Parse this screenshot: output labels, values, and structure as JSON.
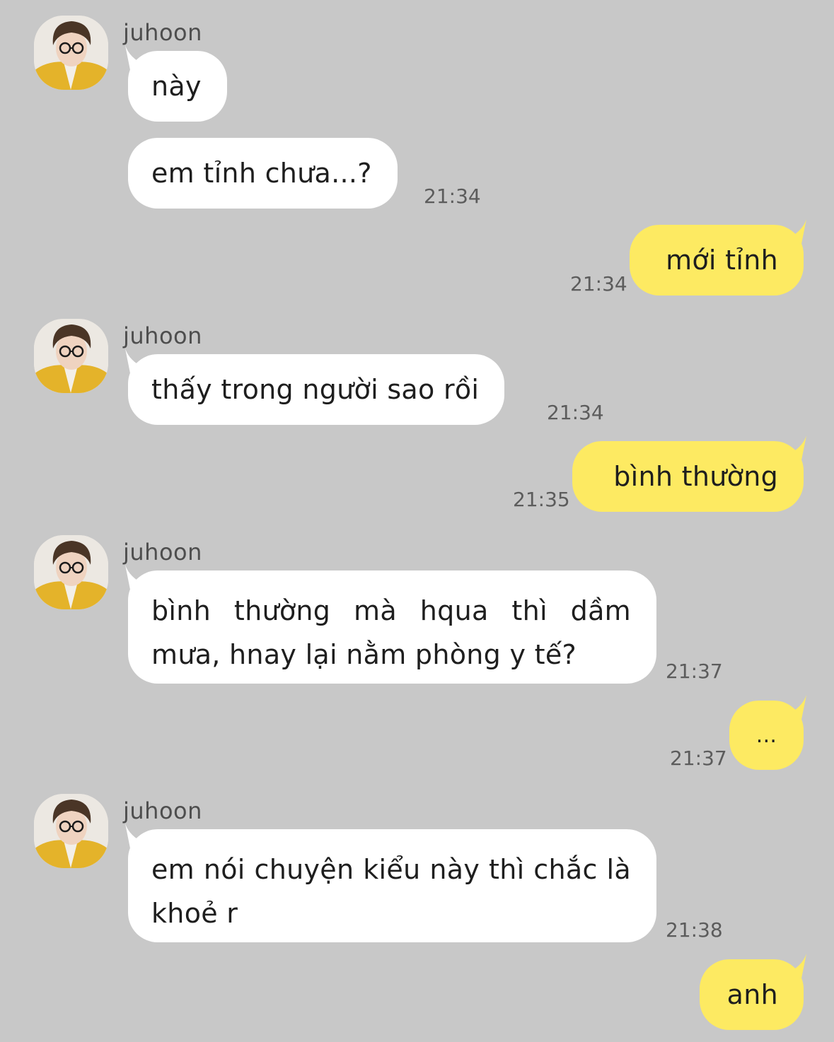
{
  "conversation": {
    "messages": [
      {
        "from": "juhoon",
        "show_avatar": true,
        "text": "này",
        "time": ""
      },
      {
        "from": "juhoon",
        "show_avatar": false,
        "text": "em tỉnh chưa...?",
        "time": "21:34"
      },
      {
        "from": "me",
        "text": "mới tỉnh",
        "time": "21:34"
      },
      {
        "from": "juhoon",
        "show_avatar": true,
        "text": "thấy trong người sao rồi",
        "time": "21:34"
      },
      {
        "from": "me",
        "text": "bình thường",
        "time": "21:35"
      },
      {
        "from": "juhoon",
        "show_avatar": true,
        "text": "bình thường mà hqua thì dầm mưa, hnay lại nằm phòng y tế?",
        "time": "21:37"
      },
      {
        "from": "me",
        "text": "...",
        "time": "21:37"
      },
      {
        "from": "juhoon",
        "show_avatar": true,
        "text": "em nói chuyện kiểu này thì chắc là khoẻ r",
        "time": "21:38"
      },
      {
        "from": "me",
        "text": "anh",
        "time": ""
      }
    ]
  },
  "colors": {
    "background": "#c8c8c8",
    "incoming_bubble": "#ffffff",
    "outgoing_bubble": "#fdea62",
    "timestamp": "#5c5c5c"
  }
}
